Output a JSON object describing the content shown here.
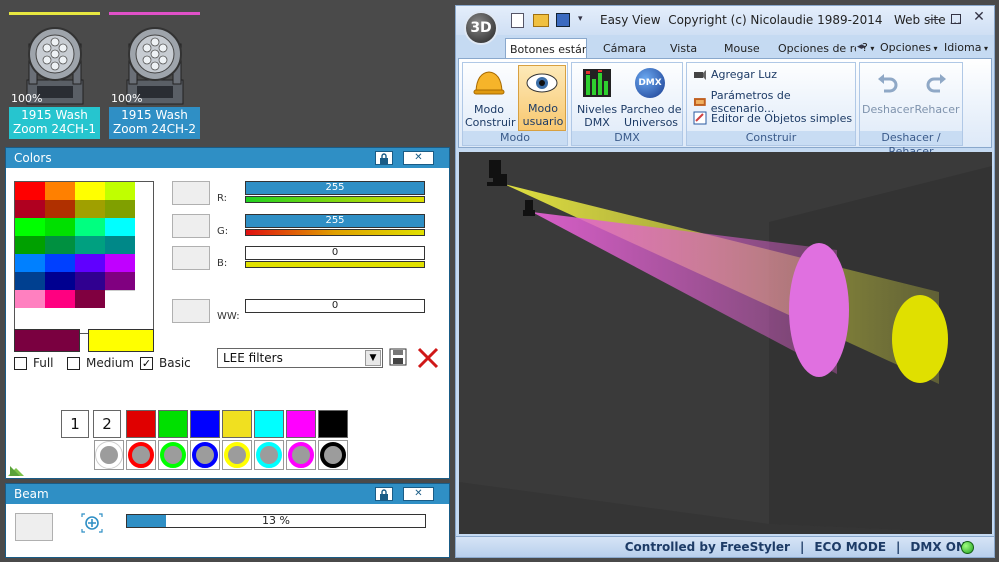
{
  "fixtures": [
    {
      "percent": "100%",
      "line1": "1915 Wash",
      "line2": "Zoom 24CH-1",
      "bar_color": "#e8e840",
      "label_bg": "#26c5cf"
    },
    {
      "percent": "100%",
      "line1": "1915 Wash",
      "line2": "Zoom 24CH-2",
      "bar_color": "#e050c8",
      "label_bg": "#2f8fc5"
    }
  ],
  "colors_panel": {
    "title": "Colors",
    "channels": [
      {
        "label": "R:",
        "value": "255",
        "level": 1.0
      },
      {
        "label": "G:",
        "value": "255",
        "level": 1.0
      },
      {
        "label": "B:",
        "value": "0",
        "level": 0.0
      },
      {
        "label": "WW:",
        "value": "0",
        "level": 0.0
      }
    ],
    "palette": [
      "#ff0000",
      "#ff8000",
      "#ffff00",
      "#c0ff00",
      "#b00020",
      "#b03000",
      "#a0a000",
      "#80a000",
      "#00ff00",
      "#00e000",
      "#00ff80",
      "#00ffff",
      "#00a000",
      "#009040",
      "#00a080",
      "#008888",
      "#0080ff",
      "#0040ff",
      "#6000ff",
      "#c000ff",
      "#004090",
      "#000090",
      "#300090",
      "#800080",
      "#ff80c0",
      "#ff0080",
      "#800040",
      "#ffffff"
    ],
    "swatch_left": "#7a0040",
    "swatch_right": "#ffff00",
    "checkboxes": [
      {
        "label": "Full",
        "checked": false
      },
      {
        "label": "Medium",
        "checked": false
      },
      {
        "label": "Basic",
        "checked": true
      }
    ],
    "filter_select": "LEE filters",
    "num_buttons": [
      "1",
      "2"
    ],
    "quick_colors": [
      "#e00000",
      "#00e000",
      "#0000ff",
      "#f0e020",
      "#00ffff",
      "#ff00ff",
      "#000000"
    ],
    "quick_rings": [
      "#ffffff",
      "#ff0000",
      "#00ff00",
      "#0000ff",
      "#ffff00",
      "#00ffff",
      "#ff00ff",
      "#000000"
    ]
  },
  "beam_panel": {
    "title": "Beam",
    "value": "13 %",
    "level": 0.13
  },
  "app": {
    "title": "Easy View  Copyright (c) Nicolaudie 1989-2014   Web site ...",
    "tabs": [
      "Botones estándar",
      "Cámara",
      "Vista",
      "Mouse",
      "Opciones de re"
    ],
    "right_menu": [
      "?",
      "Opciones",
      "Idioma"
    ],
    "modo": {
      "b1l1": "Modo",
      "b1l2": "Construir",
      "b2l1": "Modo",
      "b2l2": "usuario",
      "group": "Modo"
    },
    "dmx": {
      "b1l1": "Niveles",
      "b1l2": "DMX",
      "b2l1": "Parcheo de",
      "b2l2": "Universos",
      "group": "DMX",
      "dmx_icon": "DMX"
    },
    "construir": {
      "items": [
        "Agregar Luz",
        "Parámetros de escenario...",
        "Editor de Objetos simples"
      ],
      "group": "Construir"
    },
    "undo": {
      "b1": "Deshacer",
      "b2": "Rehacer",
      "group": "Deshacer / Rehacer"
    },
    "status": [
      "Controlled by FreeStyler",
      "ECO MODE",
      "DMX ON"
    ],
    "logo": "3D"
  }
}
